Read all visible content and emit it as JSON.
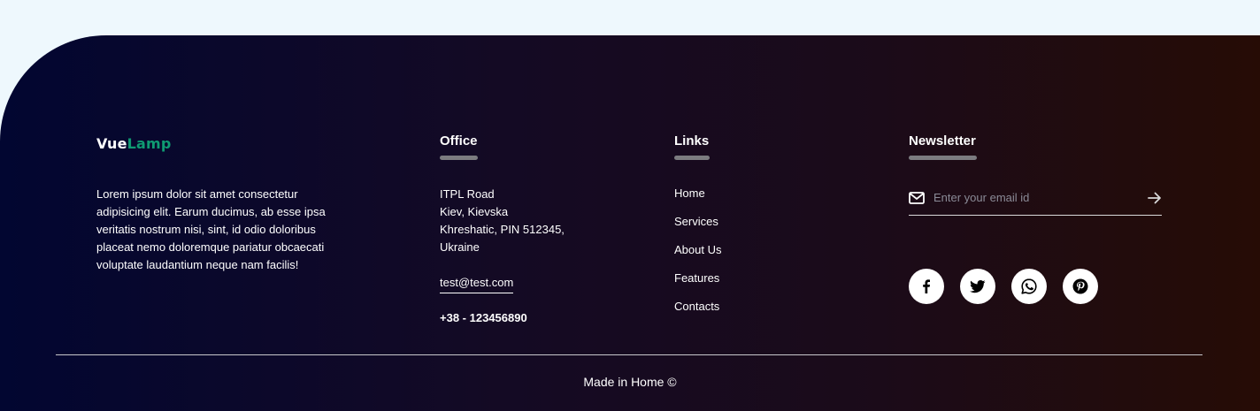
{
  "brand": {
    "part1": "Vue",
    "part2": "Lamp"
  },
  "about": {
    "text": "Lorem ipsum dolor sit amet consectetur adipisicing elit. Earum ducimus, ab esse ipsa veritatis nostrum nisi, sint, id odio doloribus placeat nemo doloremque pariatur obcaecati voluptate laudantium neque nam facilis!"
  },
  "office": {
    "title": "Office",
    "line1": "ITPL Road",
    "line2": "Kiev, Kievska",
    "line3": "Khreshatic, PIN 512345,",
    "line4": "Ukraine",
    "email": "test@test.com",
    "phone": "+38 - 123456890"
  },
  "links": {
    "title": "Links",
    "items": [
      "Home",
      "Services",
      "About Us",
      "Features",
      "Contacts"
    ]
  },
  "newsletter": {
    "title": "Newsletter",
    "placeholder": "Enter your email id",
    "value": ""
  },
  "socials": [
    "facebook-icon",
    "twitter-icon",
    "whatsapp-icon",
    "pinterest-icon"
  ],
  "colors": {
    "accent": "#0f9a72",
    "bar": "#7c7c80",
    "gradient_start": "#020631",
    "gradient_end": "#260c05"
  },
  "footer": {
    "copyright": "Made in Home ©"
  }
}
